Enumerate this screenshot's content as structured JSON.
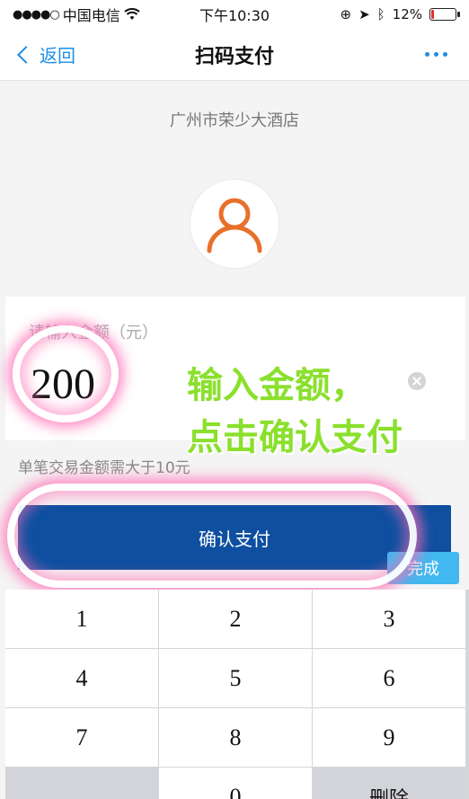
{
  "status_bar": {
    "carrier": "中国电信",
    "time": "下午10:30",
    "battery_percent": "12%",
    "battery_level": 0.12
  },
  "nav": {
    "back_label": "返回",
    "title": "扫码支付"
  },
  "merchant": {
    "name": "广州市荣少大酒店"
  },
  "amount": {
    "label": "请输入金额（元）",
    "value": "200"
  },
  "annotation": {
    "line1": "输入金额，",
    "line2": "点击确认支付"
  },
  "hint": "单笔交易金额需大于10元",
  "confirm_label": "确认支付",
  "done_label": "完成",
  "keypad": {
    "keys": [
      "1",
      "2",
      "3",
      "4",
      "5",
      "6",
      "7",
      "8",
      "9",
      "",
      "0",
      "删除"
    ]
  },
  "colors": {
    "accent": "#1c8ee6",
    "confirm_button": "#0e4fa0",
    "done_button": "#41b8ef",
    "avatar_icon": "#e8702a",
    "annotation_text": "#8ae02c"
  }
}
